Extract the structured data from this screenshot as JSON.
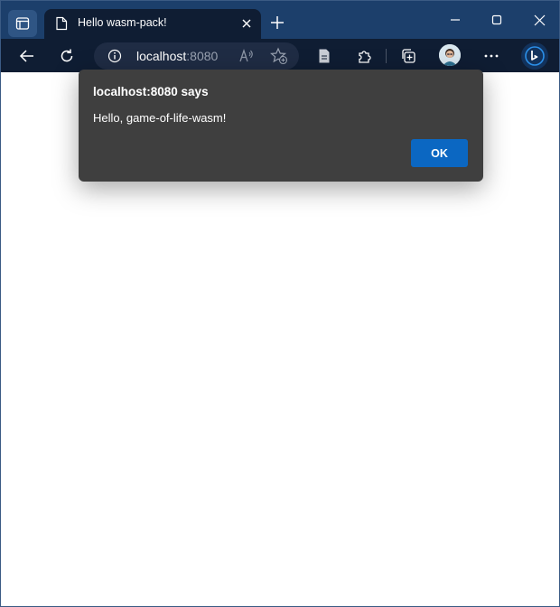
{
  "tab": {
    "title": "Hello wasm-pack!",
    "icon": "page-icon"
  },
  "address_bar": {
    "host": "localhost",
    "port": ":8080"
  },
  "dialog": {
    "title": "localhost:8080 says",
    "message": "Hello, game-of-life-wasm!",
    "ok_label": "OK"
  },
  "colors": {
    "title_bar": "#1c3f6b",
    "toolbar": "#0f1d33",
    "dialog_bg": "#3f3f3f",
    "ok_button": "#0b67c2"
  },
  "icons": {
    "toolbar": [
      "back-icon",
      "refresh-icon",
      "info-icon",
      "read-aloud-icon",
      "add-favorite-icon",
      "split-screen-icon",
      "extensions-icon",
      "collections-icon",
      "profile-avatar",
      "more-icon",
      "bing-copilot-icon"
    ],
    "window": [
      "minimize-icon",
      "maximize-icon",
      "close-icon"
    ]
  }
}
